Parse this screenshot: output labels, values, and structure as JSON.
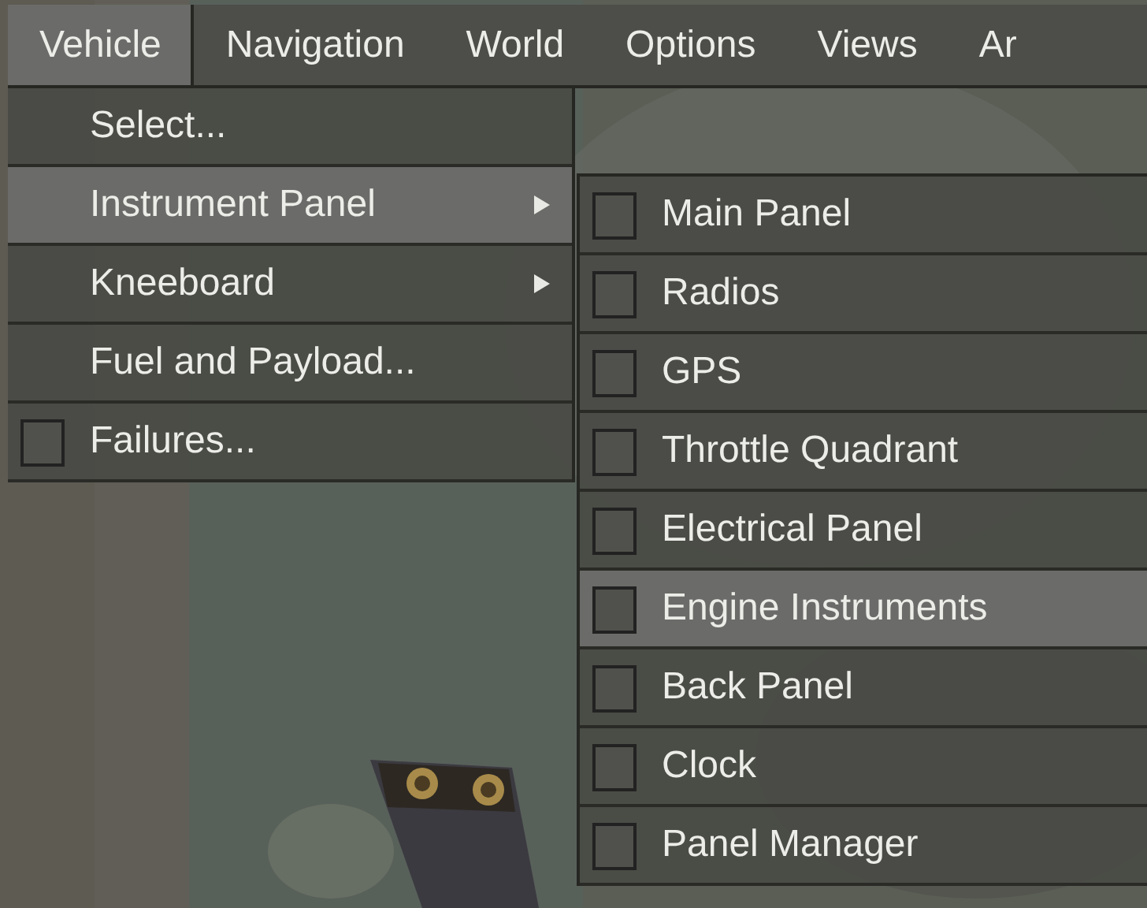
{
  "menubar": [
    {
      "label": "Vehicle",
      "selected": true
    },
    {
      "label": "Navigation",
      "selected": false
    },
    {
      "label": "World",
      "selected": false
    },
    {
      "label": "Options",
      "selected": false
    },
    {
      "label": "Views",
      "selected": false
    },
    {
      "label": "Ar",
      "selected": false
    }
  ],
  "vehicle_menu": [
    {
      "kind": "plain",
      "label": "Select...",
      "selected": false
    },
    {
      "kind": "submenu",
      "label": "Instrument Panel",
      "selected": true
    },
    {
      "kind": "submenu",
      "label": "Kneeboard",
      "selected": false
    },
    {
      "kind": "plain",
      "label": "Fuel and Payload...",
      "selected": false
    },
    {
      "kind": "checkbox",
      "label": "Failures...",
      "selected": false,
      "checked": false
    }
  ],
  "instrument_panel_menu": [
    {
      "label": "Main Panel",
      "selected": false,
      "checked": false
    },
    {
      "label": "Radios",
      "selected": false,
      "checked": false
    },
    {
      "label": "GPS",
      "selected": false,
      "checked": false
    },
    {
      "label": "Throttle Quadrant",
      "selected": false,
      "checked": false
    },
    {
      "label": "Electrical Panel",
      "selected": false,
      "checked": false
    },
    {
      "label": "Engine Instruments",
      "selected": true,
      "checked": false
    },
    {
      "label": "Back Panel",
      "selected": false,
      "checked": false
    },
    {
      "label": "Clock",
      "selected": false,
      "checked": false
    },
    {
      "label": "Panel Manager",
      "selected": false,
      "checked": false
    }
  ]
}
